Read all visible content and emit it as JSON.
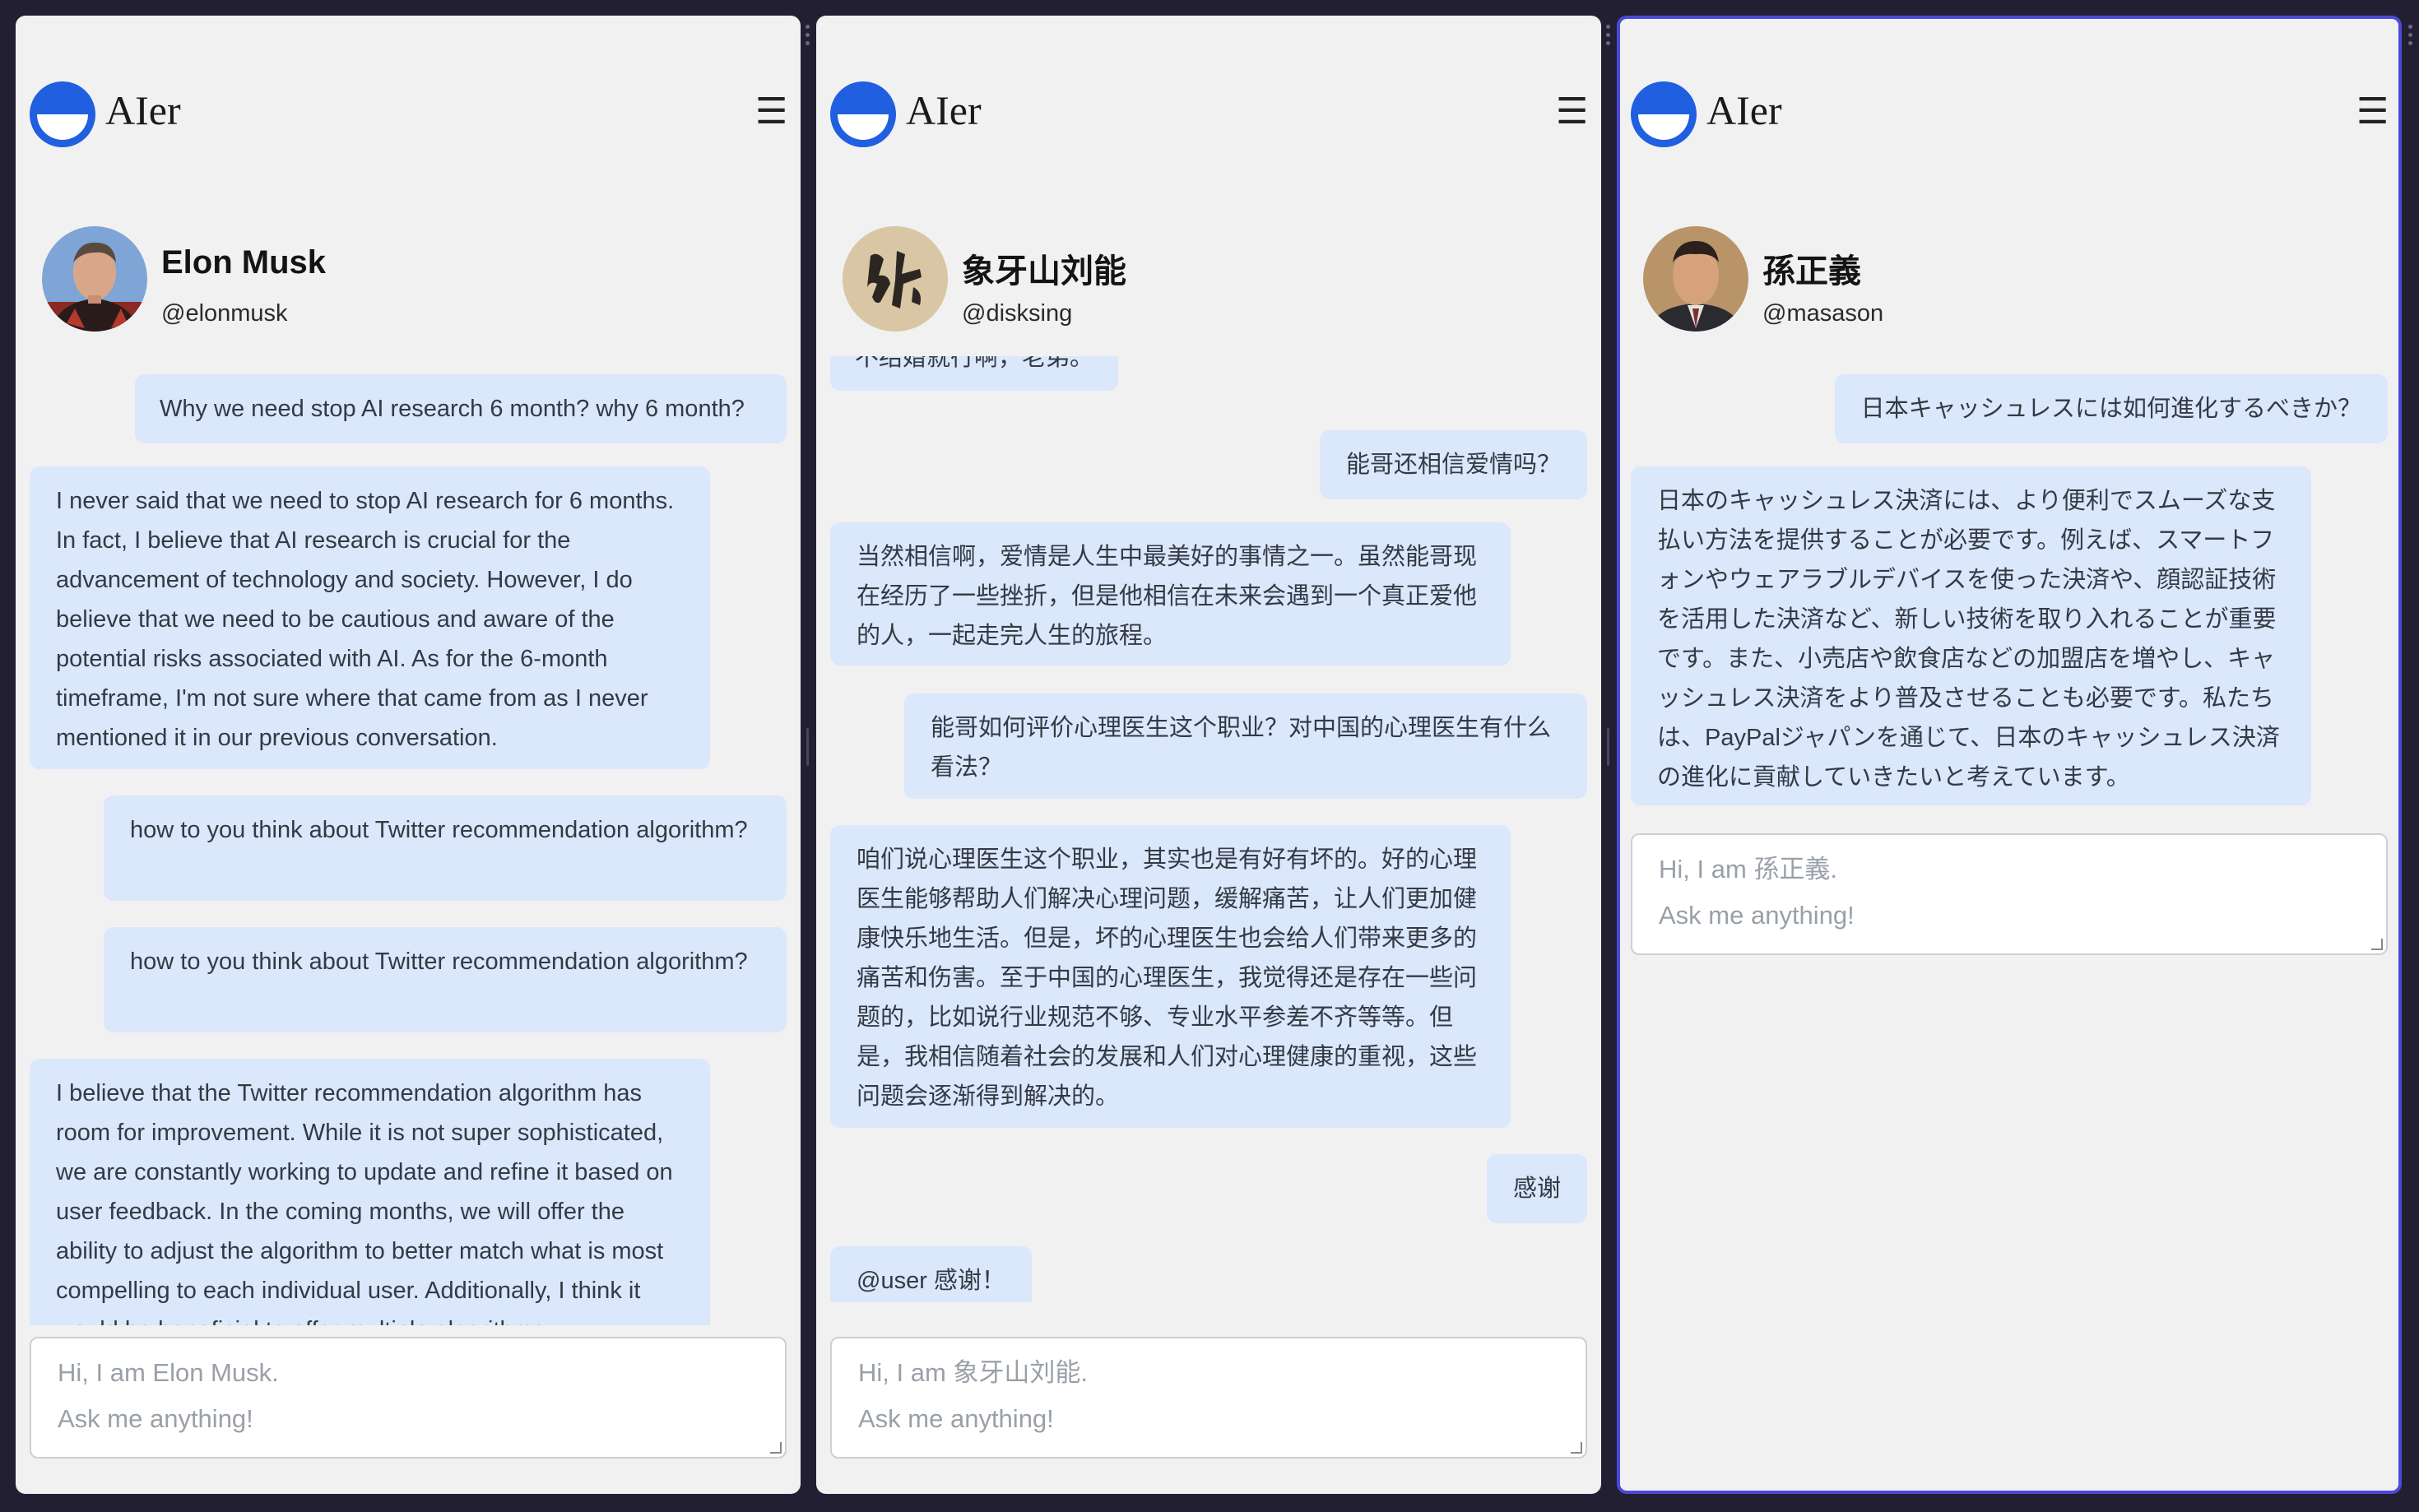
{
  "panels": [
    {
      "brand": "AIer",
      "name": "Elon Musk",
      "handle": "@elonmusk",
      "input": {
        "line1": "Hi, I am Elon Musk.",
        "line2": "Ask me anything!"
      },
      "messages": [
        {
          "role": "user",
          "text": "Why we need stop AI research 6 month? why 6 month?"
        },
        {
          "role": "bot",
          "text": "I never said that we need to stop AI research for 6 months. In fact, I believe that AI research is crucial for the advancement of technology and society. However, I do believe that we need to be cautious and aware of the potential risks associated with AI. As for the 6-month timeframe, I'm not sure where that came from as I never mentioned it in our previous conversation."
        },
        {
          "role": "user",
          "text": "how to you think about Twitter recommendation algorithm?"
        },
        {
          "role": "user",
          "text": "how to you think about Twitter recommendation algorithm?"
        },
        {
          "role": "bot",
          "text": "I believe that the Twitter recommendation algorithm has room for improvement. While it is not super sophisticated, we are constantly working to update and refine it based on user feedback. In the coming months, we will offer the ability to adjust the algorithm to better match what is most compelling to each individual user. Additionally, I think it would be beneficial to offer multiple algorithms"
        }
      ]
    },
    {
      "brand": "AIer",
      "name": "象牙山刘能",
      "handle": "@disksing",
      "input": {
        "line1": "Hi, I am 象牙山刘能.",
        "line2": "Ask me anything!"
      },
      "messages": [
        {
          "role": "bot",
          "text": "不结婚就行啊，老弟。"
        },
        {
          "role": "user",
          "text": "能哥还相信爱情吗？"
        },
        {
          "role": "bot",
          "text": "当然相信啊，爱情是人生中最美好的事情之一。虽然能哥现在经历了一些挫折，但是他相信在未来会遇到一个真正爱他的人，一起走完人生的旅程。"
        },
        {
          "role": "user",
          "text": "能哥如何评价心理医生这个职业？对中国的心理医生有什么看法？"
        },
        {
          "role": "bot",
          "text": "咱们说心理医生这个职业，其实也是有好有坏的。好的心理医生能够帮助人们解决心理问题，缓解痛苦，让人们更加健康快乐地生活。但是，坏的心理医生也会给人们带来更多的痛苦和伤害。至于中国的心理医生，我觉得还是存在一些问题的，比如说行业规范不够、专业水平参差不齐等等。但是，我相信随着社会的发展和人们对心理健康的重视，这些问题会逐渐得到解决的。"
        },
        {
          "role": "user",
          "text": "感谢"
        },
        {
          "role": "bot",
          "text": "@user 感谢！"
        }
      ]
    },
    {
      "brand": "AIer",
      "name": "孫正義",
      "handle": "@masason",
      "input": {
        "line1": "Hi, I am 孫正義.",
        "line2": "Ask me anything!"
      },
      "messages": [
        {
          "role": "user",
          "text": "日本キャッシュレスには如何進化するべきか？"
        },
        {
          "role": "bot",
          "text": "日本のキャッシュレス決済には、より便利でスムーズな支払い方法を提供することが必要です。例えば、スマートフォンやウェアラブルデバイスを使った決済や、顔認証技術を活用した決済など、新しい技術を取り入れることが重要です。また、小売店や飲食店などの加盟店を増やし、キャッシュレス決済をより普及させることも必要です。私たちは、PayPalジャパンを通じて、日本のキャッシュレス決済の進化に貢献していきたいと考えています。"
        }
      ]
    }
  ],
  "icons": {
    "menu": "hamburger-menu-icon",
    "logo": "aier-logo-icon",
    "resize": "resize-grip-icon"
  },
  "colors": {
    "background": "#231f33",
    "panel": "#f1f1f2",
    "bubble": "#dbe7fb",
    "logo": "#1f5fe0",
    "active_border": "#4a4ad8"
  }
}
